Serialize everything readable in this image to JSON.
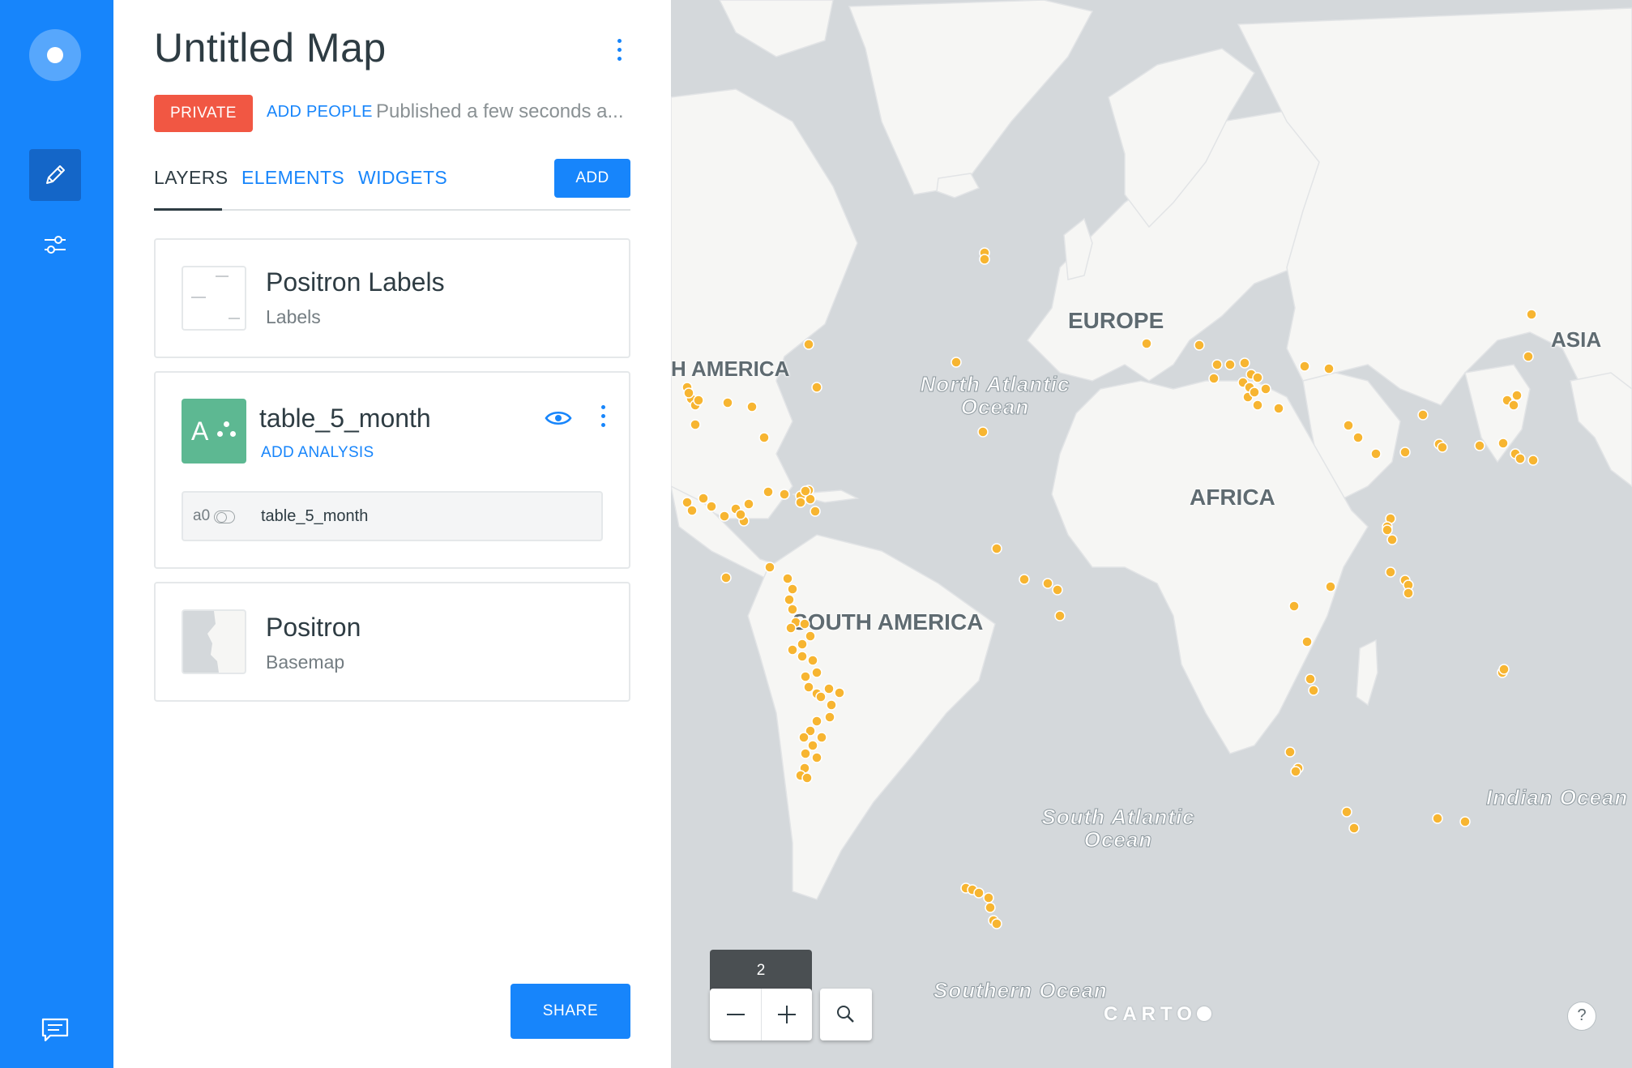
{
  "app": {
    "title": "Untitled Map",
    "privacy_badge": "PRIVATE",
    "add_people": "ADD PEOPLE",
    "published_status": "Published a few seconds a..."
  },
  "tabs": [
    {
      "label": "LAYERS",
      "active": true
    },
    {
      "label": "ELEMENTS",
      "active": false
    },
    {
      "label": "WIDGETS",
      "active": false
    }
  ],
  "add_button": "ADD",
  "layers": [
    {
      "name": "Positron Labels",
      "type": "Labels"
    },
    {
      "name": "table_5_month",
      "letter": "A",
      "add_analysis": "ADD ANALYSIS",
      "analysis_id": "a0",
      "analysis_source": "table_5_month"
    },
    {
      "name": "Positron",
      "type": "Basemap"
    }
  ],
  "share_button": "SHARE",
  "map": {
    "labels": {
      "north_america": "H AMERICA",
      "europe": "EUROPE",
      "asia": "ASIA",
      "africa": "AFRICA",
      "south_america": "SOUTH AMERICA"
    },
    "oceans": {
      "north_atlantic": "North Atlantic Ocean",
      "south_atlantic": "South Atlantic Ocean",
      "indian": "Indian Ocean",
      "southern": "Southern Ocean"
    },
    "zoom_level": "2",
    "attribution": "CARTO",
    "help": "?",
    "point_color": "#F7B531"
  },
  "colors": {
    "accent": "#1785FB",
    "private": "#F15743",
    "layer_green": "#5DB892",
    "land": "#F6F6F4",
    "water": "#D4D8DB"
  },
  "icons": [
    "pencil-icon",
    "sliders-icon",
    "chat-icon",
    "eye-icon",
    "zoom-out-icon",
    "zoom-in-icon",
    "search-icon"
  ]
}
